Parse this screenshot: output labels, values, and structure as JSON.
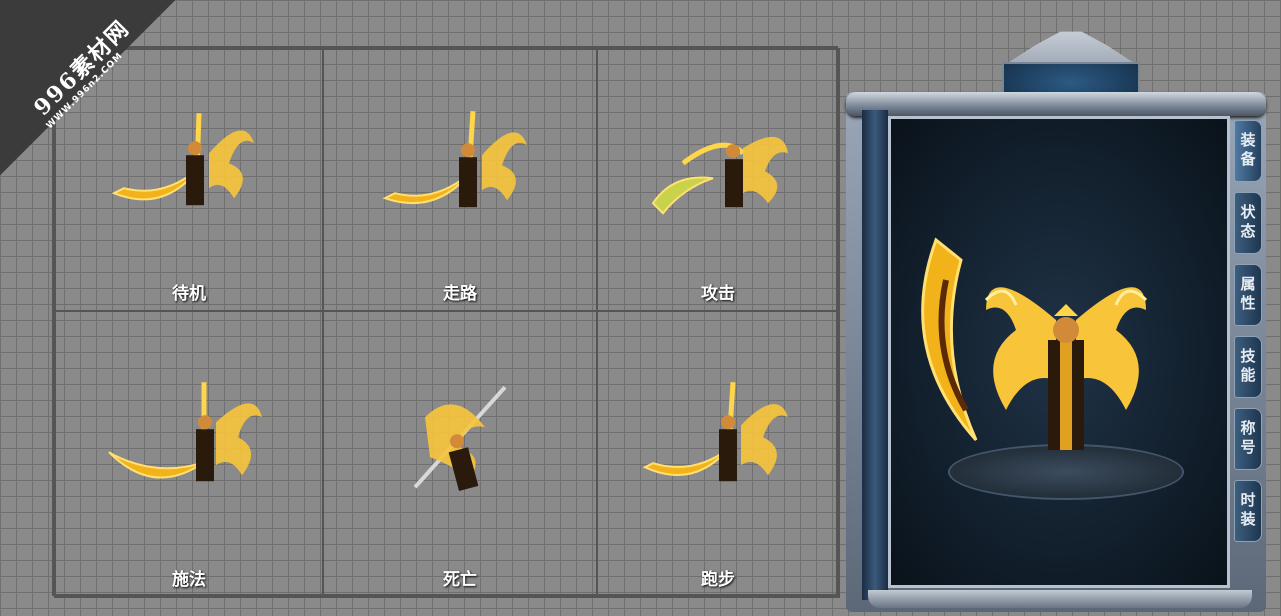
{
  "watermark": {
    "title": "996素材网",
    "url": "WWW.996n2.COM"
  },
  "animations": [
    {
      "label": "待机"
    },
    {
      "label": "走路"
    },
    {
      "label": "攻击"
    },
    {
      "label": "施法"
    },
    {
      "label": "死亡"
    },
    {
      "label": "跑步"
    }
  ],
  "panel": {
    "tabs": [
      {
        "label": "装备"
      },
      {
        "label": "状态"
      },
      {
        "label": "属性"
      },
      {
        "label": "技能"
      },
      {
        "label": "称号"
      },
      {
        "label": "时装"
      }
    ]
  },
  "colors": {
    "gold": "#f2b21a",
    "gold_light": "#ffe070",
    "panel_blue": "#1b2c44"
  }
}
